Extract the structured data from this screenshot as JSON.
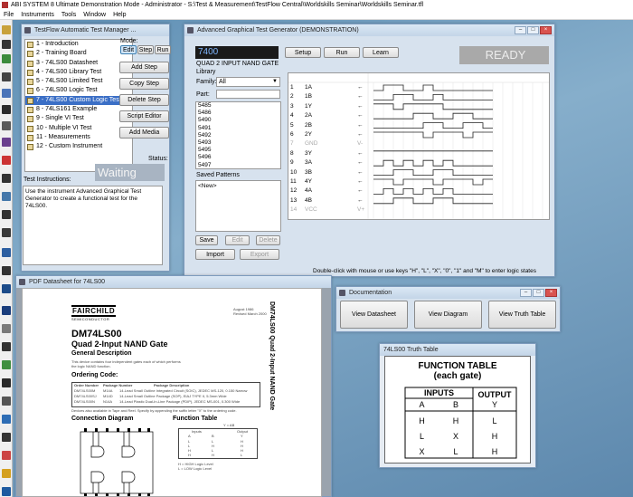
{
  "app": {
    "title": "ABI SYSTEM 8 Ultimate Demonstration Mode - Administrator - S:\\Test & Measurement\\TestFlow Central\\Worldskills Seminar\\Worldskills Seminar.tfl",
    "menu": [
      "File",
      "Instruments",
      "Tools",
      "Window",
      "Help"
    ]
  },
  "testflow": {
    "title": "TestFlow Automatic Test Manager ...",
    "mode_label": "Mode:",
    "mode_buttons": [
      "Edit",
      "Step",
      "Run"
    ],
    "steps": [
      "1 - Introduction",
      "2 - Training Board",
      "3 - 74LS00 Datasheet",
      "4 - 74LS00 Library Test",
      "5 - 74LS00 Limited Test",
      "6 - 74LS00 Logic Test",
      "7 - 74LS00 Custom Logic Test",
      "8 - 74LS161 Example",
      "9 - Single VI Test",
      "10 - Multiple VI Test",
      "11 - Measurements",
      "12 - Custom Instrument"
    ],
    "selected_step": 6,
    "buttons": [
      "Add Step",
      "Copy Step",
      "Delete Step",
      "Script Editor",
      "Add Media"
    ],
    "status_label": "Status:",
    "status_value": "Waiting",
    "instructions_label": "Test Instructions:",
    "instructions_text": "Use the instrument Advanced Graphical Test Generator to create a functional test for the 74LS00."
  },
  "agtg": {
    "title": "Advanced Graphical Test Generator (DEMONSTRATION)",
    "part_number": "7400",
    "description": "QUAD 2 INPUT NAND GATE",
    "buttons": [
      "Setup",
      "Run",
      "Learn"
    ],
    "status": "READY",
    "library_label": "Library",
    "family_label": "Family:",
    "family_value": "All",
    "part_label": "Part:",
    "part_value": "",
    "part_list": [
      "5485",
      "5486",
      "5490",
      "5491",
      "5492",
      "5493",
      "5495",
      "5496",
      "5497",
      "7400"
    ],
    "part_selected": 9,
    "saved_patterns_label": "Saved Patterns",
    "saved_patterns": [
      "<New>"
    ],
    "pattern_buttons": [
      "Save",
      "Edit",
      "Delete"
    ],
    "io_buttons": [
      "Import",
      "Export"
    ],
    "pins": [
      {
        "num": "1",
        "name": "1A",
        "dir": "←",
        "dim": false
      },
      {
        "num": "2",
        "name": "1B",
        "dir": "←",
        "dim": false
      },
      {
        "num": "3",
        "name": "1Y",
        "dir": "←",
        "dim": false
      },
      {
        "num": "4",
        "name": "2A",
        "dir": "←",
        "dim": false
      },
      {
        "num": "5",
        "name": "2B",
        "dir": "←",
        "dim": false
      },
      {
        "num": "6",
        "name": "2Y",
        "dir": "←",
        "dim": false
      },
      {
        "num": "7",
        "name": "GND",
        "dir": "V-",
        "dim": true
      },
      {
        "num": "8",
        "name": "3Y",
        "dir": "←",
        "dim": false
      },
      {
        "num": "9",
        "name": "3A",
        "dir": "←",
        "dim": false
      },
      {
        "num": "10",
        "name": "3B",
        "dir": "←",
        "dim": false
      },
      {
        "num": "11",
        "name": "4Y",
        "dir": "←",
        "dim": false
      },
      {
        "num": "12",
        "name": "4A",
        "dir": "←",
        "dim": false
      },
      {
        "num": "13",
        "name": "4B",
        "dir": "←",
        "dim": false
      },
      {
        "num": "14",
        "name": "VCC",
        "dir": "V+",
        "dim": true
      }
    ],
    "hint": "Double-click with mouse or use keys \"H\", \"L\", \"X\", \"0\", \"1\" and \"M\" to enter logic states"
  },
  "documentation": {
    "title": "Documentation",
    "buttons": [
      "View Datasheet",
      "View Diagram",
      "View Truth Table"
    ]
  },
  "pdf": {
    "title": "PDF Datasheet for 74LS00",
    "brand": "FAIRCHILD",
    "brand_sub": "SEMICONDUCTOR",
    "dates": "August 1986\nRevised March 2000",
    "side_title": "DM74LS00 Quad 2-Input NAND Gate",
    "part": "DM74LS00",
    "subtitle": "Quad 2-Input NAND Gate",
    "general_heading": "General Description",
    "general_text": "This device contains four independent gates each of which performs the logic NAND function.",
    "ordering_heading": "Ordering Code:",
    "ordering_headers": [
      "Order Number",
      "Package Number",
      "Package Description"
    ],
    "ordering_rows": [
      [
        "DM74LS00M",
        "M14A",
        "14-Lead Small Outline Integrated Circuit (SOIC), JEDEC MS-120, 0.150 Narrow"
      ],
      [
        "DM74LS00SJ",
        "M14D",
        "14-Lead Small Outline Package (SOP), EIAJ TYPE II, 5.3mm Wide"
      ],
      [
        "DM74LS00N",
        "N14A",
        "14-Lead Plastic Dual-In-Line Package (PDIP), JEDEC MS-001, 0.300 Wide"
      ]
    ],
    "ordering_note": "Devices also available in Tape and Reel. Specify by appending the suffix letter \"X\" to the ordering code.",
    "connection_heading": "Connection Diagram",
    "function_heading": "Function Table",
    "function_eq": "Y = AB",
    "function_headers": [
      "Inputs",
      "Output"
    ],
    "function_cols": [
      "A",
      "B",
      "Y"
    ],
    "function_rows": [
      [
        "L",
        "L",
        "H"
      ],
      [
        "L",
        "H",
        "H"
      ],
      [
        "H",
        "L",
        "H"
      ],
      [
        "H",
        "H",
        "L"
      ]
    ],
    "function_notes": "H = HIGH Logic Level\nL = LOW Logic Level"
  },
  "truth_table": {
    "title": "74LS00 Truth Table",
    "heading1": "FUNCTION TABLE",
    "heading2": "(each gate)",
    "group_inputs": "INPUTS",
    "group_output": "OUTPUT",
    "cols": [
      "A",
      "B",
      "Y"
    ],
    "rows": [
      [
        "H",
        "H",
        "L"
      ],
      [
        "L",
        "X",
        "H"
      ],
      [
        "X",
        "L",
        "H"
      ]
    ]
  }
}
